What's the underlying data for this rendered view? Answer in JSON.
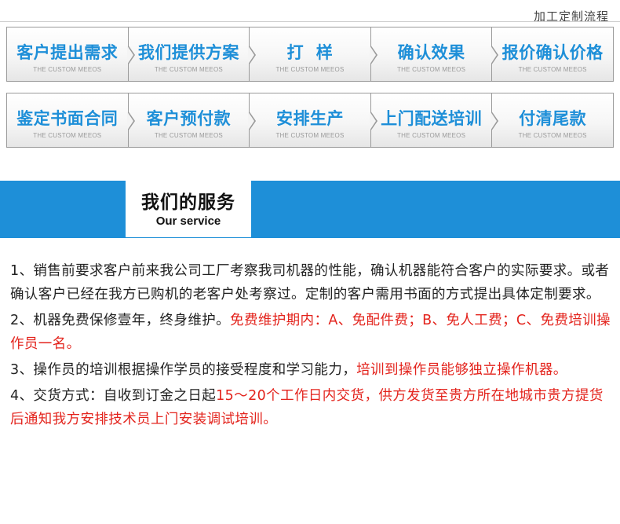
{
  "header": {
    "label": "加工定制流程"
  },
  "flow": {
    "row1": [
      {
        "title": "客户提出需求",
        "sub": "THE CUSTOM MEEOS"
      },
      {
        "title": "我们提供方案",
        "sub": "THE CUSTOM MEEOS"
      },
      {
        "title": "打  样",
        "sub": "THE CUSTOM MEEOS"
      },
      {
        "title": "确认效果",
        "sub": "THE CUSTOM MEEOS"
      },
      {
        "title": "报价确认价格",
        "sub": "THE CUSTOM MEEOS"
      }
    ],
    "row2": [
      {
        "title": "鉴定书面合同",
        "sub": "THE CUSTOM MEEOS"
      },
      {
        "title": "客户预付款",
        "sub": "THE CUSTOM MEEOS"
      },
      {
        "title": "安排生产",
        "sub": "THE CUSTOM MEEOS"
      },
      {
        "title": "上门配送培训",
        "sub": "THE CUSTOM MEEOS"
      },
      {
        "title": "付清尾款",
        "sub": "THE CUSTOM MEEOS"
      }
    ]
  },
  "service": {
    "title": "我们的服务",
    "subtitle": "Our service"
  },
  "items": [
    {
      "text": "1、销售前要求客户前来我公司工厂考察我司机器的性能，确认机器能符合客户的实际要求。或者确认客户已经在我方已购机的老客户处考察过。定制的客户需用书面的方式提出具体定制要求。",
      "highlight": ""
    },
    {
      "text": "2、机器免费保修壹年，终身维护。",
      "highlight": "免费维护期内：A、免配件费；B、免人工费；C、免费培训操作员一名。"
    },
    {
      "text": "3、操作员的培训根据操作学员的接受程度和学习能力，",
      "highlight": "培训到操作员能够独立操作机器。"
    },
    {
      "text": "4、交货方式：自收到订金之日起",
      "highlight": "15～20个工作日内交货，供方发货至贵方所在地城市贵方提货后通知我方安排技术员上门安装调试培训。"
    }
  ],
  "colors": {
    "accent": "#1e8fd8",
    "highlight": "#e3231c"
  }
}
